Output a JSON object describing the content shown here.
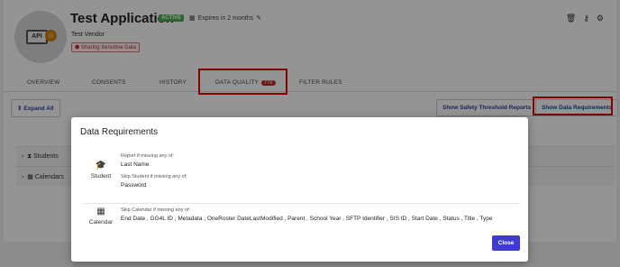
{
  "app": {
    "title": "Test Application",
    "status_badge": "ACTIVE",
    "expires": "Expires in 2 months",
    "vendor": "Test Vendor",
    "sensitive_label": "Sharing Sensitive Data",
    "logo_text": "API"
  },
  "tabs": [
    {
      "label": "OVERVIEW"
    },
    {
      "label": "CONSENTS"
    },
    {
      "label": "HISTORY"
    },
    {
      "label": "DATA QUALITY",
      "count": "776"
    },
    {
      "label": "FILTER RULES"
    }
  ],
  "toolbar": {
    "expand_all": "Expand All",
    "safety_reports": "Show Safety Threshold Reports",
    "data_requirements": "Show Data Requirements"
  },
  "tree": {
    "students": "Students",
    "calendars": "Calendars"
  },
  "modal": {
    "title": "Data Requirements",
    "student": {
      "entity": "Student",
      "report_caption": "Report if missing any of:",
      "report_fields": "Last Name",
      "skip_caption": "Skip Student if missing any of:",
      "skip_fields": "Password"
    },
    "calendar": {
      "entity": "Calendar",
      "skip_caption": "Skip Calendar if missing any of:",
      "skip_fields": "End Date , GG4L ID , Metadata , OneRoster DateLastModified , Parent , School Year , SFTP Identifier , SIS ID , Start Date , Status , Title , Type"
    },
    "close_label": "Close"
  },
  "colors": {
    "accent": "#3d3ccc",
    "highlight_box": "#e00000",
    "active_badge": "#4caf50",
    "count_badge": "#c62828"
  }
}
